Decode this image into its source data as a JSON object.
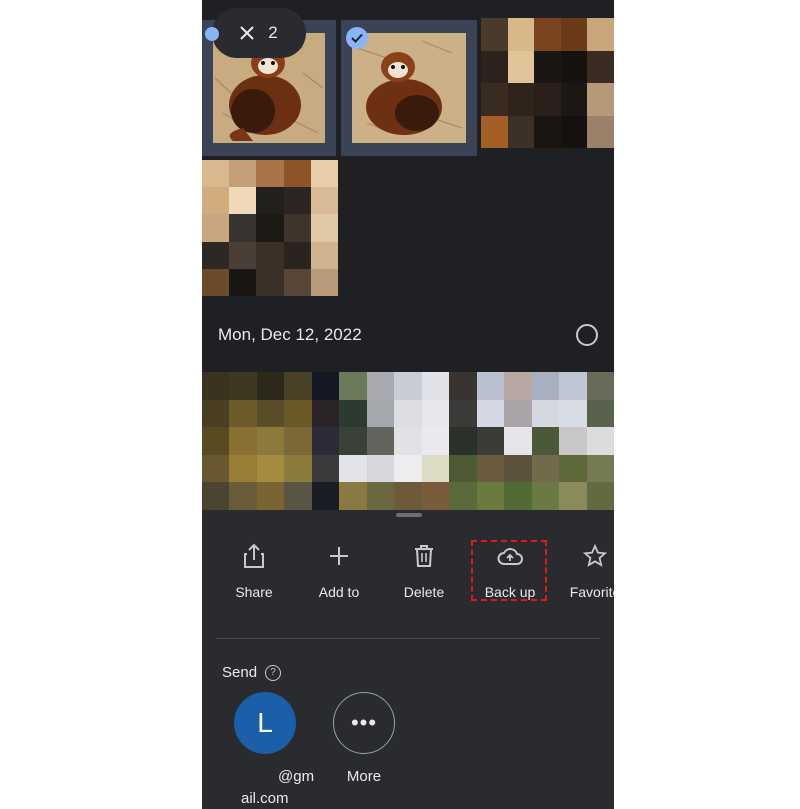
{
  "selection": {
    "close_icon": "close-icon",
    "count": "2"
  },
  "date_header": {
    "label": "Mon, Dec 12, 2022"
  },
  "actions": [
    {
      "label": "Share",
      "icon": "share-icon"
    },
    {
      "label": "Add to",
      "icon": "plus-icon"
    },
    {
      "label": "Delete",
      "icon": "trash-icon"
    },
    {
      "label": "Back up",
      "icon": "cloud-upload-icon"
    },
    {
      "label": "Favorite",
      "icon": "star-icon"
    }
  ],
  "send": {
    "label": "Send",
    "contacts": [
      {
        "initial": "L",
        "name_line1": "@gm",
        "name_line2": "ail.com"
      },
      {
        "label": "More",
        "icon": "more-dots-icon"
      }
    ]
  },
  "colors": {
    "background": "#1f2023",
    "sheet": "#2a2b2f",
    "accent": "#8ab4f8",
    "avatar": "#1b5fa8",
    "highlight": "#e0191c"
  }
}
